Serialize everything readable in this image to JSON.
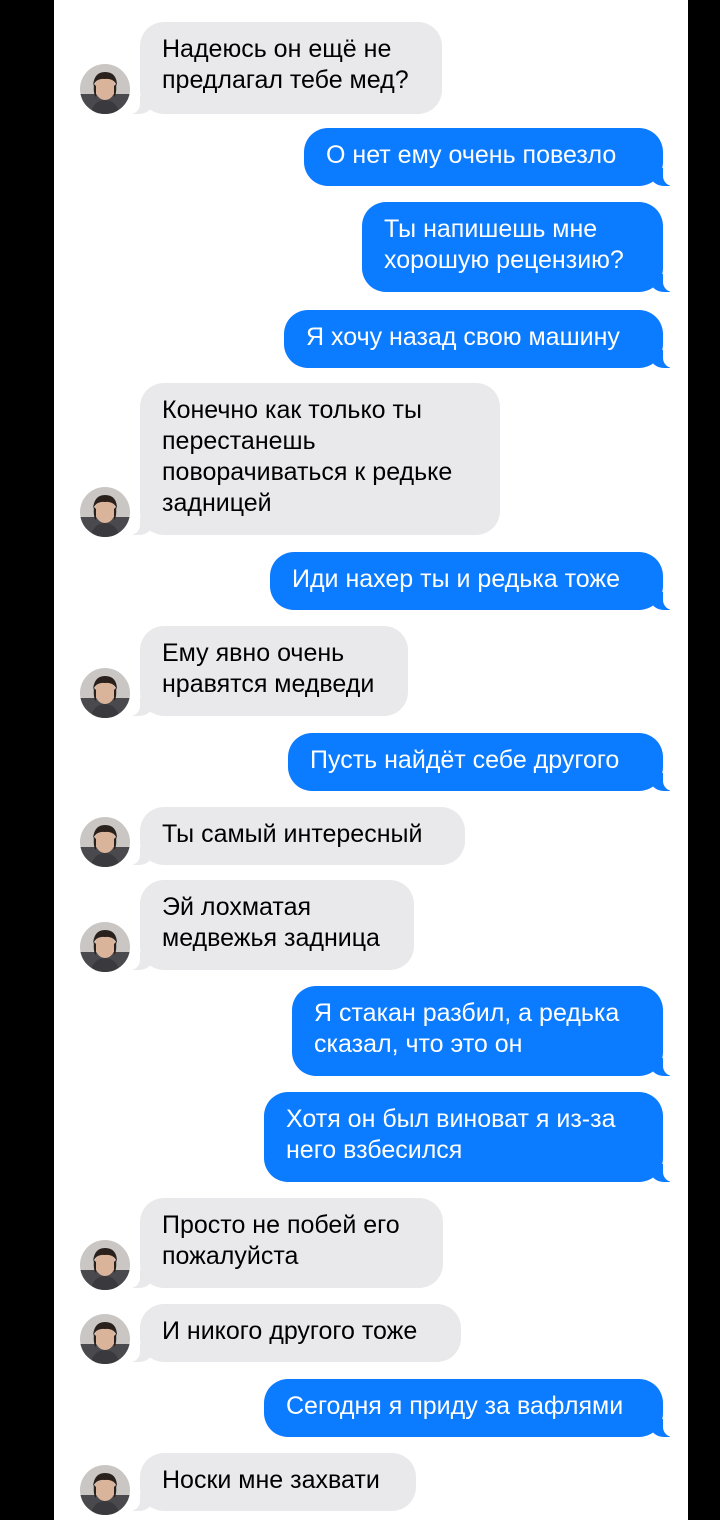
{
  "colors": {
    "outgoing_bubble": "#0b7bff",
    "incoming_bubble": "#e9e9eb",
    "background": "#ffffff",
    "frame": "#000000"
  },
  "contact": {
    "avatar_icon": "contact-photo-icon"
  },
  "messages": [
    {
      "direction": "in",
      "text": "Надеюсь он ещё не предлагал тебе мед?"
    },
    {
      "direction": "out",
      "text": "О нет ему очень повезло"
    },
    {
      "direction": "out",
      "text": "Ты напишешь мне хорошую рецензию?"
    },
    {
      "direction": "out",
      "text": "Я хочу назад свою машину"
    },
    {
      "direction": "in",
      "text": "Конечно как только ты перестанешь поворачиваться к редьке задницей"
    },
    {
      "direction": "out",
      "text": "Иди нахер ты и редька тоже"
    },
    {
      "direction": "in",
      "text": "Ему явно очень нравятся медведи"
    },
    {
      "direction": "out",
      "text": "Пусть найдёт себе другого"
    },
    {
      "direction": "in",
      "text": "Ты самый интересный"
    },
    {
      "direction": "in",
      "text": "Эй лохматая медвежья задница"
    },
    {
      "direction": "out",
      "text": "Я стакан разбил, а редька сказал, что это он"
    },
    {
      "direction": "out",
      "text": "Хотя он был виноват я из-за него взбесился"
    },
    {
      "direction": "in",
      "text": "Просто не побей его пожалуйста"
    },
    {
      "direction": "in",
      "text": "И никого другого тоже"
    },
    {
      "direction": "out",
      "text": "Сегодня я приду за вафлями"
    },
    {
      "direction": "in",
      "text": "Носки мне захвати"
    }
  ]
}
